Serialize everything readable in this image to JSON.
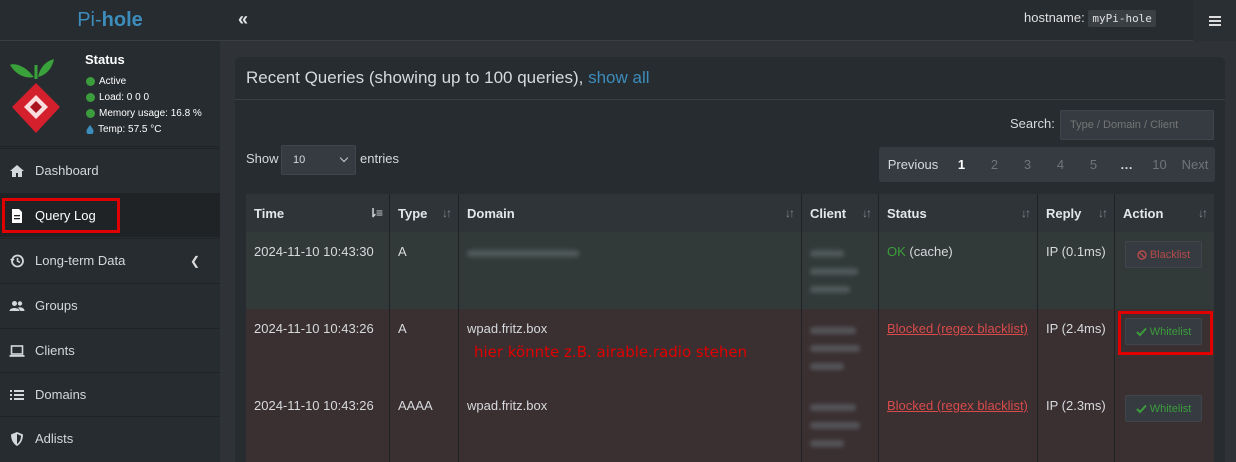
{
  "app": {
    "logo_prefix": "Pi-",
    "logo_bold": "hole"
  },
  "topbar": {
    "toggle_icon": "«",
    "hostname_label": "hostname:",
    "hostname_value": "myPi-hole"
  },
  "sidebar": {
    "status": {
      "title": "Status",
      "active": "Active",
      "load": "Load:  0  0  0",
      "memory": "Memory usage:  16.8 %",
      "temp": "Temp: 57.5 °C"
    },
    "items": [
      {
        "label": "Dashboard",
        "icon": "home-icon"
      },
      {
        "label": "Query Log",
        "icon": "file-icon"
      },
      {
        "label": "Long-term Data",
        "icon": "history-icon"
      },
      {
        "label": "Groups",
        "icon": "users-icon"
      },
      {
        "label": "Clients",
        "icon": "laptop-icon"
      },
      {
        "label": "Domains",
        "icon": "list-icon"
      },
      {
        "label": "Adlists",
        "icon": "shield-icon"
      }
    ]
  },
  "main": {
    "title": "Recent Queries (showing up to 100 queries), ",
    "show_all": "show all",
    "search_label": "Search:",
    "search_placeholder": "Type / Domain / Client",
    "show_label": "Show",
    "page_length": "10",
    "entries_label": "entries",
    "pager": {
      "prev": "Previous",
      "pages": [
        "1",
        "2",
        "3",
        "4",
        "5",
        "…",
        "10"
      ],
      "next": "Next",
      "current": "1"
    },
    "columns": [
      "Time",
      "Type",
      "Domain",
      "Client",
      "Status",
      "Reply",
      "Action"
    ],
    "rows": [
      {
        "time": "2024-11-10 10:43:30",
        "type": "A",
        "domain": "",
        "status_ok": "OK",
        "status_rest": " (cache)",
        "reply": "IP (0.1ms)",
        "action": "Blacklist"
      },
      {
        "time": "2024-11-10 10:43:26",
        "type": "A",
        "domain": "wpad.fritz.box",
        "status": "Blocked (regex blacklist)",
        "reply": "IP (2.4ms)",
        "action": "Whitelist"
      },
      {
        "time": "2024-11-10 10:43:26",
        "type": "AAAA",
        "domain": "wpad.fritz.box",
        "status": "Blocked (regex blacklist)",
        "reply": "IP (2.3ms)",
        "action": "Whitelist"
      }
    ],
    "annotation": "hier könnte z.B. airable.radio stehen"
  },
  "colors": {
    "accent": "#3c8dbc",
    "ok": "#3c9d3c",
    "blocked": "#d84b4b",
    "highlight": "#e00000"
  }
}
